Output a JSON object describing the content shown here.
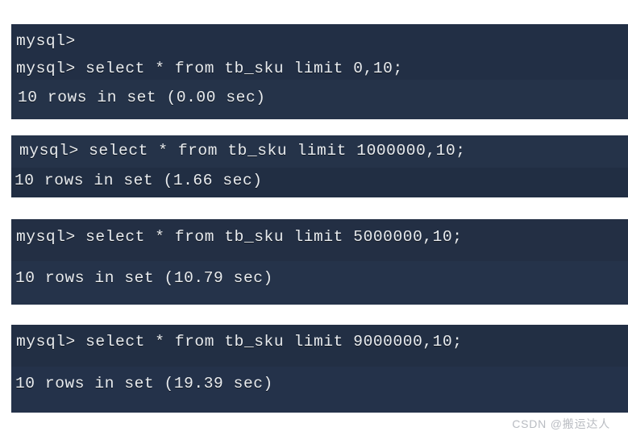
{
  "page": {
    "background_color": "#ffffff",
    "terminal_background_color": "#243247",
    "terminal_text_color": "#e9ecef"
  },
  "watermark": {
    "text": "CSDN @搬运达人",
    "color": "#b9bcc2"
  },
  "terminal_blocks": [
    {
      "id": "block-1",
      "lines": [
        "mysql>",
        "mysql> select * from tb_sku limit 0,10;",
        "10 rows in set (0.00 sec)"
      ]
    },
    {
      "id": "block-2",
      "lines": [
        "mysql> select * from tb_sku limit 1000000,10;",
        "10 rows in set (1.66 sec)"
      ]
    },
    {
      "id": "block-3",
      "lines": [
        "mysql> select * from tb_sku limit 5000000,10;",
        "10 rows in set (10.79 sec)"
      ]
    },
    {
      "id": "block-4",
      "lines": [
        "mysql> select * from tb_sku limit 9000000,10;",
        "10 rows in set (19.39 sec)"
      ]
    }
  ],
  "benchmark": {
    "table": "tb_sku",
    "prompt": "mysql>",
    "rows_returned": 10,
    "queries": [
      {
        "offset": 0,
        "limit": 10,
        "elapsed_seconds": 0.0,
        "result_text": "10 rows in set (0.00 sec)"
      },
      {
        "offset": 1000000,
        "limit": 10,
        "elapsed_seconds": 1.66,
        "result_text": "10 rows in set (1.66 sec)"
      },
      {
        "offset": 5000000,
        "limit": 10,
        "elapsed_seconds": 10.79,
        "result_text": "10 rows in set (10.79 sec)"
      },
      {
        "offset": 9000000,
        "limit": 10,
        "elapsed_seconds": 19.39,
        "result_text": "10 rows in set (19.39 sec)"
      }
    ]
  }
}
